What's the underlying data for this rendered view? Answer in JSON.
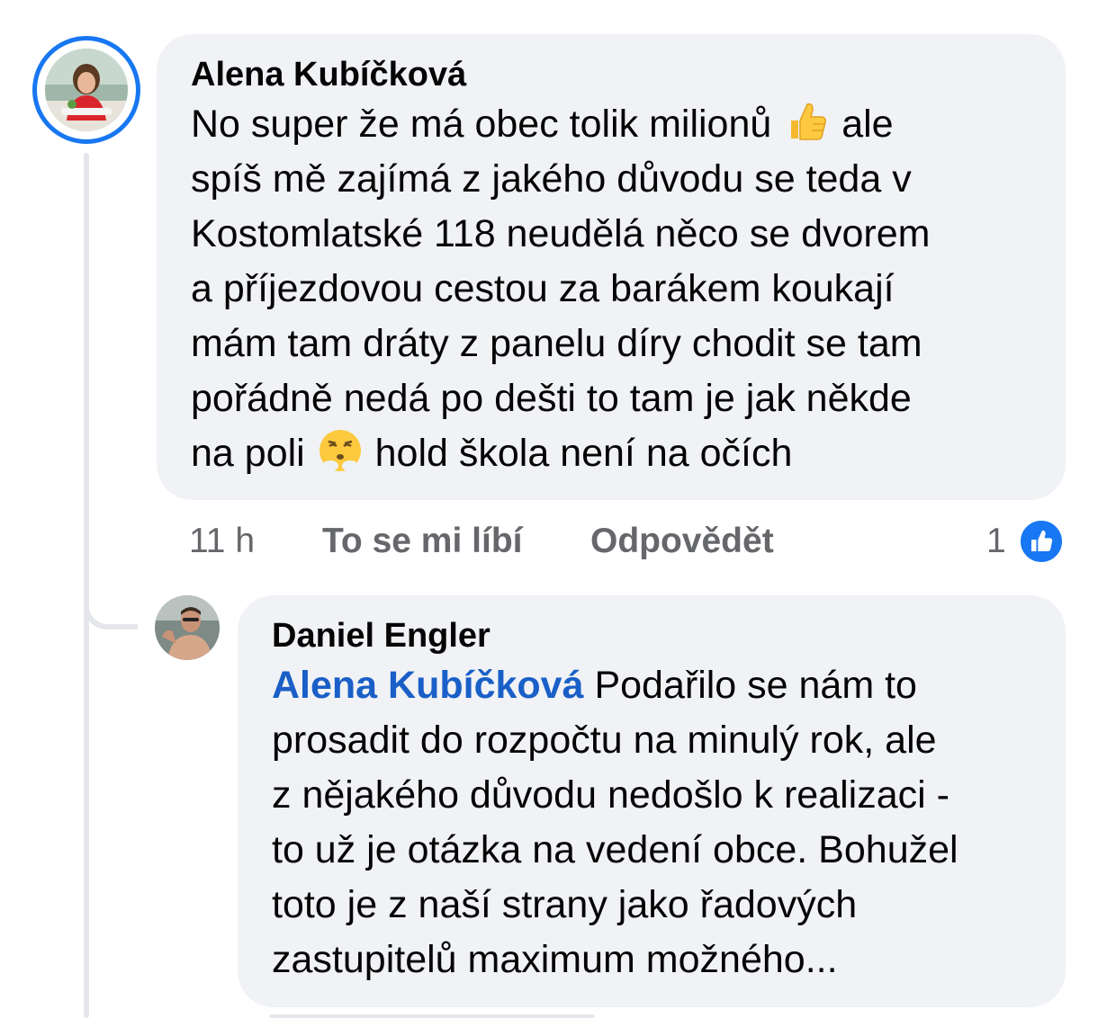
{
  "colors": {
    "bubble_bg": "#f0f2f5",
    "accent_blue": "#1877f2",
    "mention_blue": "#1a5fc7",
    "meta_gray": "#65676b",
    "thread_line": "#e4e6eb"
  },
  "comment": {
    "author": "Alena Kubíčková",
    "avatar_icon": "profile-photo-woman",
    "lines": [
      {
        "a": "No super že má obec tolik milionů ",
        "emoji": "thumbs-up-emoji",
        "b": " ale"
      },
      {
        "a": "spíš mě zajímá z jakého důvodu   se teda  v"
      },
      {
        "a": "Kostomlatské 118 neudělá něco se dvorem"
      },
      {
        "a": "a příjezdovou cestou za barákem koukají"
      },
      {
        "a": "mám tam dráty z panelu díry chodit se tam"
      },
      {
        "a": "pořádně nedá po dešti to tam je jak někde"
      },
      {
        "a": "na poli  ",
        "emoji": "face-with-steam-emoji",
        "b": " hold škola není na očích"
      }
    ],
    "time": "11 h",
    "like_label": "To se mi líbí",
    "reply_label": "Odpovědět",
    "reaction_count": "1",
    "reaction_icon": "like-reaction-icon"
  },
  "reply": {
    "author": "Daniel Engler",
    "avatar_icon": "profile-photo-man",
    "mention": "Alena Kubíčková",
    "lines": [
      {
        "a": " Podařilo se nám to"
      },
      {
        "a": "prosadit do rozpočtu na minulý rok, ale"
      },
      {
        "a": "z nějakého důvodu nedošlo k realizaci -"
      },
      {
        "a": "to už je otázka na vedení obce. Bohužel"
      },
      {
        "a": "toto je z naší strany jako řadových"
      },
      {
        "a": "zastupitelů maximum možného..."
      }
    ]
  }
}
